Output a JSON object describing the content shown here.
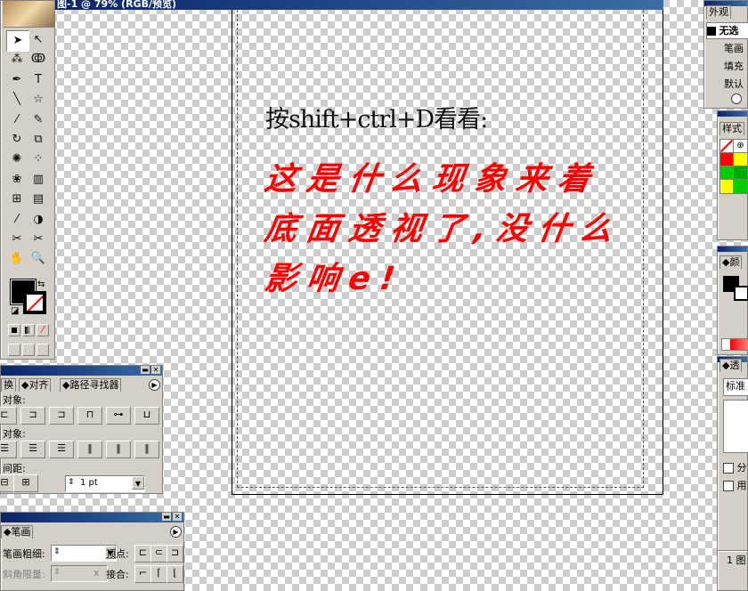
{
  "document": {
    "title": "图-1 @ 79% (RGB/预览)"
  },
  "artwork": {
    "line1": "按shift+ctrl+D看看:",
    "line2": "这是什么现象来着",
    "line3": "底面透视了,没什么",
    "line4": "影响e!"
  },
  "toolbox": {
    "tools": [
      {
        "icon": "selection-arrow-icon",
        "glyph": "➤"
      },
      {
        "icon": "direct-selection-icon",
        "glyph": "↖"
      },
      {
        "icon": "magic-wand-icon",
        "glyph": "⁂"
      },
      {
        "icon": "lasso-icon",
        "glyph": "ↂ"
      },
      {
        "icon": "pen-icon",
        "glyph": "✒"
      },
      {
        "icon": "type-icon",
        "glyph": "T"
      },
      {
        "icon": "line-icon",
        "glyph": "╲"
      },
      {
        "icon": "star-icon",
        "glyph": "☆"
      },
      {
        "icon": "paintbrush-icon",
        "glyph": "⁄"
      },
      {
        "icon": "pencil-icon",
        "glyph": "✎"
      },
      {
        "icon": "rotate-icon",
        "glyph": "↻"
      },
      {
        "icon": "scale-icon",
        "glyph": "⧉"
      },
      {
        "icon": "warp-icon",
        "glyph": "✺"
      },
      {
        "icon": "free-transform-icon",
        "glyph": "⁘"
      },
      {
        "icon": "symbol-sprayer-icon",
        "glyph": "❀"
      },
      {
        "icon": "graph-icon",
        "glyph": "▥"
      },
      {
        "icon": "mesh-icon",
        "glyph": "⊞"
      },
      {
        "icon": "gradient-icon",
        "glyph": "▤"
      },
      {
        "icon": "eyedropper-icon",
        "glyph": "⁄"
      },
      {
        "icon": "blend-icon",
        "glyph": "◑"
      },
      {
        "icon": "slice-icon",
        "glyph": "✂"
      },
      {
        "icon": "scissors-icon",
        "glyph": "✂"
      },
      {
        "icon": "hand-icon",
        "glyph": "✋"
      },
      {
        "icon": "zoom-icon",
        "glyph": "🔍"
      }
    ],
    "fill_color": "#000000",
    "stroke_color": "#ffffff"
  },
  "align_panel": {
    "tabs": [
      "换",
      "对齐",
      "路径寻找器"
    ],
    "section_align_objects": "对象:",
    "section_distribute_objects": "对象:",
    "section_distribute_spacing": "间距:",
    "spacing_value": "1 pt"
  },
  "stroke_panel": {
    "tab": "笔画",
    "weight_label": "笔画粗细:",
    "cap_label": "顶点:",
    "miter_label": "斜角限量:",
    "miter_unit": "x",
    "join_label": "接合:"
  },
  "appearance_panel": {
    "tab": "外观",
    "object": "无选",
    "items": [
      "笔画",
      "填充",
      "默认"
    ]
  },
  "swatches_panel": {
    "tab": "样式",
    "colors": [
      "#ffffff",
      "#ffffff",
      "#ff0000",
      "#ffff00",
      "#00cc00",
      "#00aa00",
      "#ffff00",
      "#00cc00"
    ]
  },
  "color_panel": {
    "tab": "颜"
  },
  "transparency_panel": {
    "tab": "透",
    "mode": "标准",
    "option1": "分",
    "option2": "用"
  },
  "layers_panel": {
    "status": "1 图"
  }
}
